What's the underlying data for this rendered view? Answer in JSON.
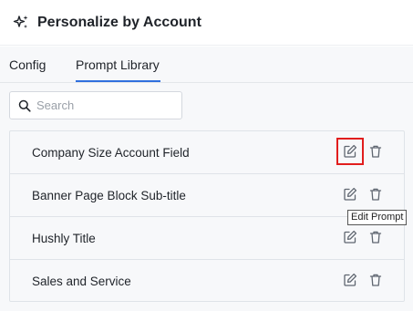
{
  "header": {
    "icon": "sparkle-icon",
    "title": "Personalize by Account"
  },
  "tabs": [
    {
      "label": "Config",
      "active": false
    },
    {
      "label": "Prompt Library",
      "active": true
    }
  ],
  "colors": {
    "accent": "#2f6fde",
    "highlight": "#e11d1d",
    "panel_bg": "#f7f8fa"
  },
  "search": {
    "placeholder": "Search",
    "value": "",
    "icon": "search-icon"
  },
  "prompts": [
    {
      "label": "Company Size Account Field",
      "edit_icon": "edit-icon",
      "delete_icon": "trash-icon"
    },
    {
      "label": "Banner Page Block Sub-title",
      "edit_icon": "edit-icon",
      "delete_icon": "trash-icon"
    },
    {
      "label": "Hushly Title",
      "edit_icon": "edit-icon",
      "delete_icon": "trash-icon"
    },
    {
      "label": "Sales and Service",
      "edit_icon": "edit-icon",
      "delete_icon": "trash-icon"
    }
  ],
  "tooltip": {
    "text": "Edit Prompt"
  }
}
